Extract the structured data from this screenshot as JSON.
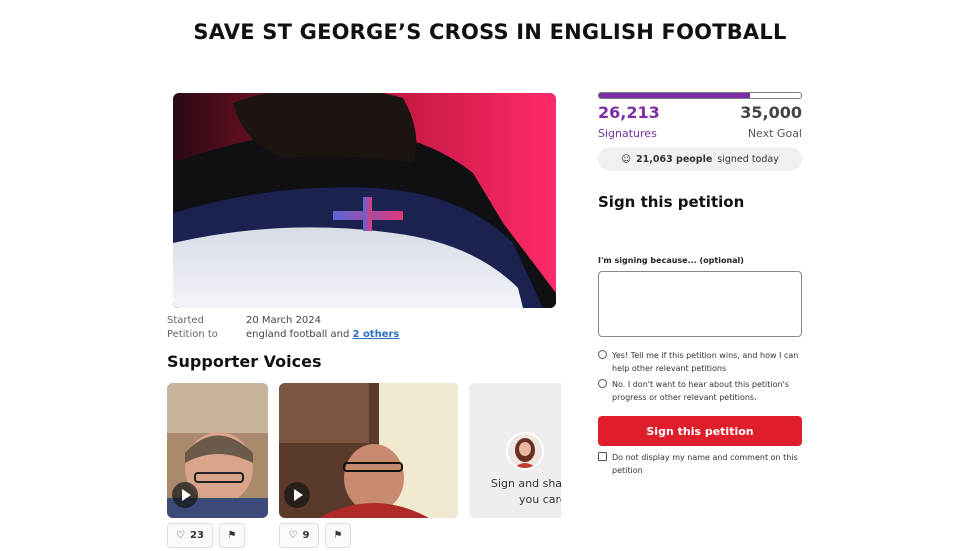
{
  "page_title": "SAVE ST GEORGE’S CROSS IN ENGLISH FOOTBALL",
  "meta": {
    "started_label": "Started",
    "started_value": "20 March 2024",
    "petition_to_label": "Petition to",
    "petition_to_value": "england football and",
    "others_link": "2 others"
  },
  "supporter_voices": {
    "heading": "Supporter Voices",
    "cards": [
      {
        "likes": "23"
      },
      {
        "likes": "9"
      }
    ],
    "cta_text": "Sign and share why you care!"
  },
  "progress": {
    "signatures": "26,213",
    "signatures_label": "Signatures",
    "goal": "35,000",
    "goal_label": "Next Goal",
    "fraction": 0.749,
    "today_count": "21,063 people",
    "today_suffix": "signed today"
  },
  "sign_form": {
    "heading": "Sign this petition",
    "reason_label": "I'm signing because... (optional)",
    "reason_value": "",
    "option_yes": "Yes! Tell me if this petition wins, and how I can help other relevant petitions",
    "option_no": "No. I don't want to hear about this petition's progress or other relevant petitions.",
    "button": "Sign this petition",
    "hide_name": "Do not display my name and comment on this petition"
  },
  "colors": {
    "accent": "#7c2ea6",
    "button": "#e01e2b"
  }
}
